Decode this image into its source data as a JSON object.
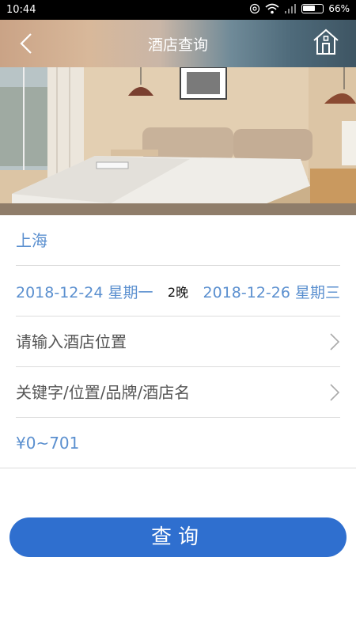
{
  "status_bar": {
    "time": "10:44",
    "battery": "66%",
    "battery_level": 0.66
  },
  "header": {
    "title": "酒店查询",
    "back_icon": "back-arrow-icon",
    "home_icon": "home-icon"
  },
  "form": {
    "city": "上海",
    "check_in": "2018-12-24 星期一",
    "nights": "2晚",
    "check_out": "2018-12-26 星期三",
    "location_placeholder": "请输入酒店位置",
    "keyword_placeholder": "关键字/位置/品牌/酒店名",
    "price_range": "¥0~701"
  },
  "search_button": {
    "label": "查询"
  },
  "colors": {
    "accent_text": "#5a8fcf",
    "button": "#2f6fcf"
  }
}
